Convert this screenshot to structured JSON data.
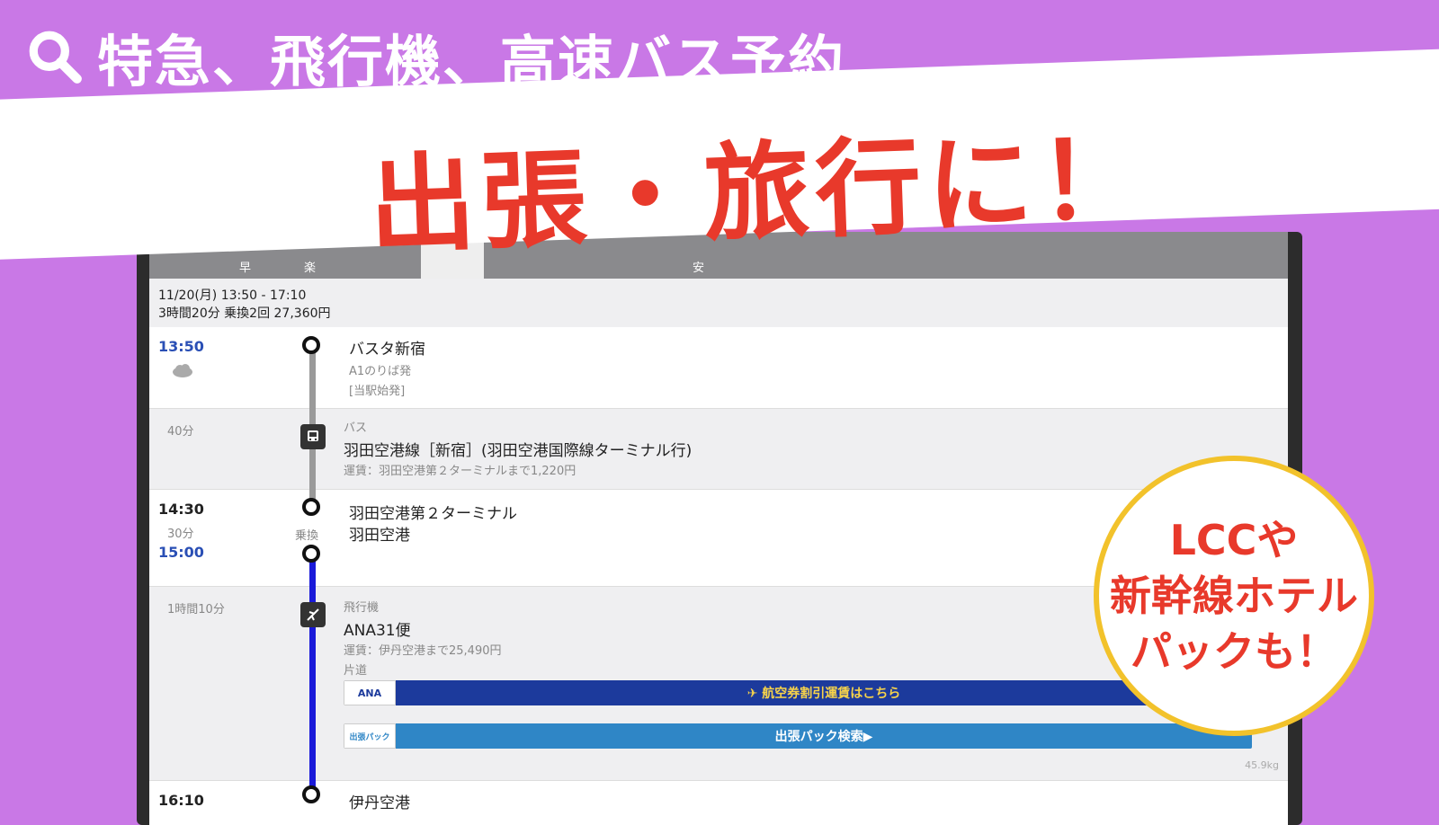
{
  "headline": {
    "text": "特急、飛行機、高速バス予約"
  },
  "banner": {
    "text": "出張・旅行に！"
  },
  "bubble": {
    "line1": "LCCや",
    "line2": "新幹線ホテル",
    "line3": "パックも！"
  },
  "tabs": [
    {
      "label": "早"
    },
    {
      "label": "楽"
    },
    {
      "label": "安"
    }
  ],
  "summary": {
    "line1": "11/20(月) 13:50 - 17:10",
    "line2": "3時間20分 乗換2回 27,360円"
  },
  "route": {
    "dep_time": "13:50",
    "dep_station": "バスタ新宿",
    "dep_platform": "A1のりば発",
    "dep_note": "[当駅始発]",
    "bus_duration": "40分",
    "bus_type": "バス",
    "bus_name": "羽田空港線［新宿］(羽田空港国際線ターミナル行)",
    "bus_fare": "運賃：羽田空港第２ターミナルまで1,220円",
    "arr_time": "14:30",
    "transfer_wait": "30分",
    "transfer_label": "乗換",
    "dep_time2": "15:00",
    "transfer_station": "羽田空港第２ターミナル",
    "transfer_station2": "羽田空港",
    "flight_duration": "1時間10分",
    "flight_type": "飛行機",
    "flight_name": "ANA31便",
    "flight_fare": "運賃：伊丹空港まで25,490円",
    "flight_note": "片道",
    "ana_logo": "ANA",
    "ana_button": "✈ 航空券割引運賃はこちら",
    "pack_logo": "出張パック",
    "pack_button": "出張パック検索▶",
    "co2": "45.9kg",
    "next_time": "16:10",
    "next_station": "伊丹空港"
  },
  "colors": {
    "bg": "#c978e6",
    "red": "#e8392b",
    "ana": "#1c3a9c",
    "pack": "#2f86c6"
  }
}
